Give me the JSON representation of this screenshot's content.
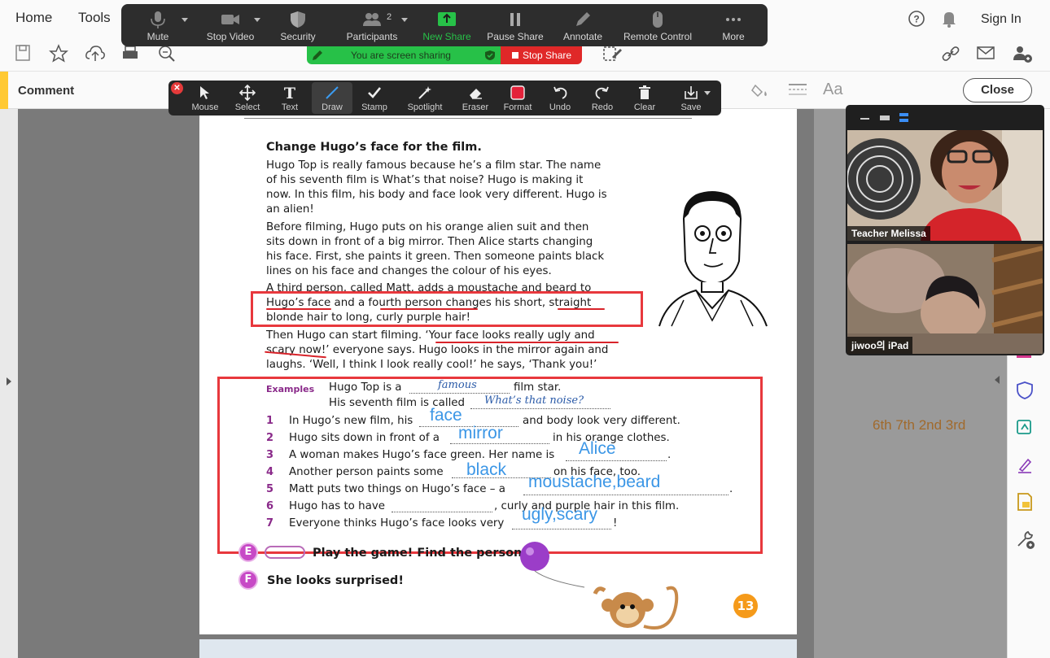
{
  "menu": {
    "home": "Home",
    "tools": "Tools",
    "sign_in": "Sign In"
  },
  "zoom_bar": {
    "items": [
      {
        "label": "Mute",
        "icon": "microphone-icon"
      },
      {
        "label": "Stop Video",
        "icon": "video-camera-icon"
      },
      {
        "label": "Security",
        "icon": "shield-icon"
      },
      {
        "label": "Participants",
        "icon": "participants-icon",
        "count": "2"
      },
      {
        "label": "New Share",
        "icon": "share-up-arrow-icon"
      },
      {
        "label": "Pause Share",
        "icon": "pause-icon"
      },
      {
        "label": "Annotate",
        "icon": "pencil-icon"
      },
      {
        "label": "Remote Control",
        "icon": "mouse-icon"
      },
      {
        "label": "More",
        "icon": "more-dots-icon"
      }
    ],
    "accent": "#27c148"
  },
  "share_banner": {
    "message": "You are screen sharing",
    "stop": "Stop Share"
  },
  "annotation_bar": {
    "tools": [
      "Mouse",
      "Select",
      "Text",
      "Draw",
      "Stamp",
      "Spotlight",
      "Eraser",
      "Format",
      "Undo",
      "Redo",
      "Clear",
      "Save"
    ],
    "active": "Draw"
  },
  "comment_bar": {
    "label": "Comment",
    "close": "Close"
  },
  "video": {
    "participant1": "Teacher Melissa",
    "participant2": "jiwoo의 iPad"
  },
  "side_note": "6th 7th 2nd 3rd",
  "page": {
    "heading": "Change Hugo’s face for the film.",
    "para1": [
      "Hugo Top is really famous because he’s a film star. The name",
      "of his seventh film is What’s that noise? Hugo is making it",
      "now. In this film, his body and face look very different. Hugo is",
      "an alien!"
    ],
    "para2": [
      "Before filming, Hugo puts on his orange alien suit and then",
      "sits down in front of a big mirror. Then Alice starts changing",
      "his face. First, she paints it green. Then someone paints black",
      "lines on his face and changes the colour of his eyes."
    ],
    "para3": [
      "A third person, called Matt, adds a moustache and beard to",
      "Hugo’s face and a fourth person changes his short, straight",
      "blonde hair to long, curly purple hair!"
    ],
    "para4": [
      "Then Hugo can start filming. ‘Your face looks really ugly and",
      "scary now!’ everyone says. Hugo looks in the mirror again and",
      "laughs. ‘Well, I think I look really cool!’ he says, ‘Thank you!’"
    ],
    "examples_label": "Examples",
    "example1": "Hugo Top is a",
    "example1_end": "film star.",
    "example1_answer": "famous",
    "example2": "His seventh film is called",
    "example2_answer": "What’s that noise?",
    "questions": [
      {
        "n": "1",
        "before": "In Hugo’s new film, his",
        "after": "and body look very different.",
        "answer": "face"
      },
      {
        "n": "2",
        "before": "Hugo sits down in front of a",
        "after": "in his orange clothes.",
        "answer": "mirror"
      },
      {
        "n": "3",
        "before": "A woman makes Hugo’s face green. Her name is",
        "after": ".",
        "answer": "Alice"
      },
      {
        "n": "4",
        "before": "Another person paints some",
        "after": "on his face, too.",
        "answer": "black"
      },
      {
        "n": "5",
        "before": "Matt puts two things on Hugo’s face – a",
        "after": ".",
        "answer": "moustache,beard"
      },
      {
        "n": "6",
        "before": "Hugo has to have",
        "after": ", curly and purple hair in this film.",
        "answer": ""
      },
      {
        "n": "7",
        "before": "Everyone thinks Hugo’s face looks very",
        "after": "!",
        "answer": "ugly,scary"
      }
    ],
    "section_e_letter": "E",
    "section_e": "Play the game! Find the person.",
    "section_f_letter": "F",
    "section_f": "She looks surprised!",
    "page_number": "13"
  }
}
